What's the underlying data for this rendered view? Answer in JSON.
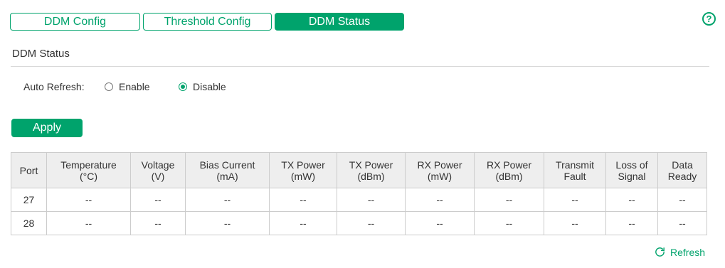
{
  "tabs": [
    {
      "label": "DDM Config"
    },
    {
      "label": "Threshold Config"
    },
    {
      "label": "DDM Status"
    }
  ],
  "help": {
    "glyph": "?"
  },
  "section_title": "DDM Status",
  "auto_refresh": {
    "label": "Auto Refresh:",
    "options": [
      {
        "label": "Enable",
        "checked": false
      },
      {
        "label": "Disable",
        "checked": true
      }
    ]
  },
  "apply_label": "Apply",
  "table": {
    "headers": [
      [
        "Port"
      ],
      [
        "Temperature",
        "(°C)"
      ],
      [
        "Voltage",
        "(V)"
      ],
      [
        "Bias Current",
        "(mA)"
      ],
      [
        "TX Power",
        "(mW)"
      ],
      [
        "TX Power",
        "(dBm)"
      ],
      [
        "RX Power",
        "(mW)"
      ],
      [
        "RX Power",
        "(dBm)"
      ],
      [
        "Transmit",
        "Fault"
      ],
      [
        "Loss of",
        "Signal"
      ],
      [
        "Data",
        "Ready"
      ]
    ],
    "rows": [
      [
        "27",
        "--",
        "--",
        "--",
        "--",
        "--",
        "--",
        "--",
        "--",
        "--",
        "--"
      ],
      [
        "28",
        "--",
        "--",
        "--",
        "--",
        "--",
        "--",
        "--",
        "--",
        "--",
        "--"
      ]
    ]
  },
  "refresh_label": "Refresh",
  "colors": {
    "accent": "#00a36c",
    "header_bg": "#eeeeee",
    "border": "#cccccc"
  }
}
